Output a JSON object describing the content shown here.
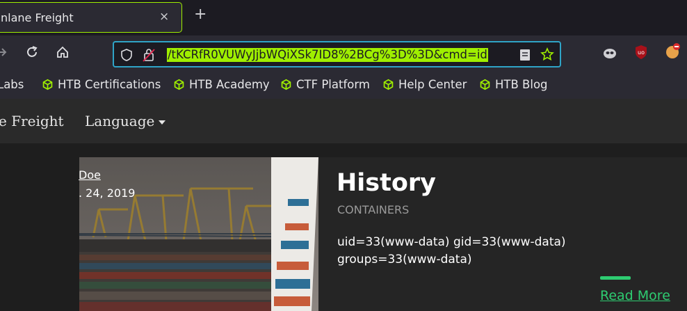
{
  "tab": {
    "title": "nlane Freight",
    "close": "×",
    "new_tab": "+"
  },
  "navbar": {
    "url": "/tKCRfR0VUWyJjbWQiXSk7ID8%2BCg%3D%3D&cmd=id",
    "back_icon": "arrow-right-icon",
    "reload_icon": "reload-icon",
    "home_icon": "home-icon"
  },
  "bookmarks": [
    {
      "label": "Labs"
    },
    {
      "label": "HTB Certifications"
    },
    {
      "label": "HTB Academy"
    },
    {
      "label": "CTF Platform"
    },
    {
      "label": "Help Center"
    },
    {
      "label": "HTB Blog"
    }
  ],
  "site": {
    "brand": "e Freight",
    "language": "Language"
  },
  "post": {
    "author": "Doe",
    "date": ". 24, 2019",
    "title": "History",
    "category": "CONTAINERS",
    "body": "uid=33(www-data) gid=33(www-data) groups=33(www-data)",
    "read_more": "Read More"
  },
  "colors": {
    "accent": "#9fef00",
    "url_focus": "#2fa4c7",
    "link": "#2ecc71"
  }
}
